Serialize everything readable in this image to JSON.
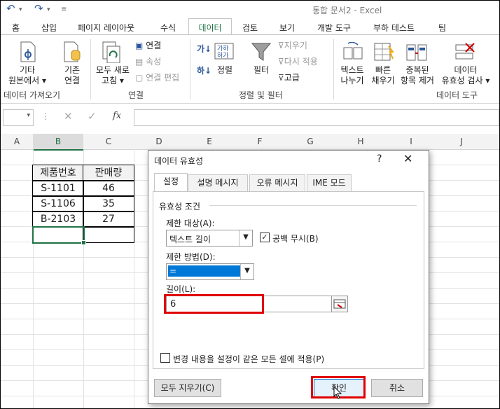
{
  "window": {
    "title": "통합 문서2 - Excel"
  },
  "tabs": [
    "홈",
    "삽입",
    "페이지 레이아웃",
    "수식",
    "데이터",
    "검토",
    "보기",
    "개발 도구",
    "부하 테스트",
    "팀"
  ],
  "active_tab": "데이터",
  "ribbon": {
    "get_external": {
      "label1": "기타",
      "label2": "원본에서 ▾"
    },
    "existing_conn": {
      "label1": "기존",
      "label2": "연결"
    },
    "refresh_all": {
      "label1": "모두 새로",
      "label2": "고침 ▾"
    },
    "connections": "연결",
    "properties": "속성",
    "edit_links": "연결 편집",
    "sort": "정렬",
    "filter": "필터",
    "clear": "지우기",
    "reapply": "다시 적용",
    "advanced": "고급",
    "text_to_columns": {
      "label1": "텍스트",
      "label2": "나누기"
    },
    "flash_fill": {
      "label1": "빠른",
      "label2": "채우기"
    },
    "remove_dup": {
      "label1": "중복된",
      "label2": "항목 제거"
    },
    "validation": {
      "label1": "데이터",
      "label2": "유효성 검사 ▾"
    },
    "group_get": "데이터 가져오기",
    "group_conn": "연결",
    "group_sort": "정렬 및 필터",
    "group_tools": "데이터 도구"
  },
  "formula_bar": {
    "fx": "fx",
    "value": ""
  },
  "columns": [
    "A",
    "B",
    "C",
    "D",
    "E",
    "F",
    "G",
    "H",
    "I",
    "J"
  ],
  "table": {
    "headers": [
      "제품번호",
      "판매량"
    ],
    "rows": [
      [
        "S-1101",
        "46"
      ],
      [
        "S-1106",
        "35"
      ],
      [
        "B-2103",
        "27"
      ]
    ]
  },
  "dialog": {
    "title": "데이터 유효성",
    "help": "?",
    "close": "✕",
    "tabs": [
      "설정",
      "설명 메시지",
      "오류 메시지",
      "IME 모드"
    ],
    "section": "유효성 조건",
    "allow_label": "제한 대상(A):",
    "allow_value": "텍스트 길이",
    "ignore_blank": "공백 무시(B)",
    "data_label": "제한 방법(D):",
    "data_value": "=",
    "length_label": "길이(L):",
    "length_value": "6",
    "apply_all": "변경 내용을 설정이 같은 모든 셀에 적용(P)",
    "clear_all": "모두 지우기(C)",
    "ok": "확인",
    "cancel": "취소"
  }
}
